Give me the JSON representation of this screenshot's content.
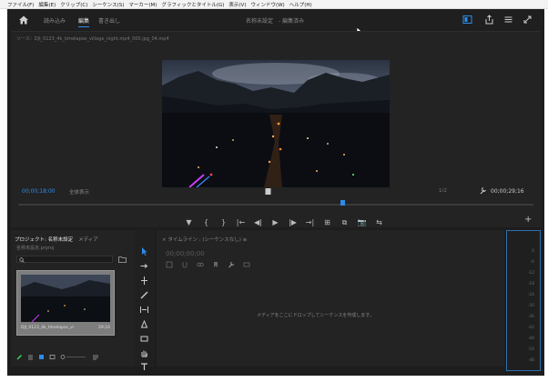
{
  "menu": [
    "ファイル(F)",
    "編集(E)",
    "クリップ(C)",
    "シーケンス(S)",
    "マーカー(M)",
    "グラフィックとタイトル(G)",
    "表示(V)",
    "ウィンドウ(W)",
    "ヘルプ(H)"
  ],
  "workspace": {
    "tabs": [
      "読み込み",
      "編集",
      "書き出し"
    ],
    "active_tab": "編集",
    "project_name": "名称未設定",
    "project_status": "- 編集済み"
  },
  "source_monitor": {
    "path": "ソース：DJI_0123_4k_timelapse_village_night.mp4_000.jpg_04.mp4",
    "timecode_current": "00;00;18;00",
    "fit_label": "全体表示",
    "quality_label": "1/2",
    "timecode_duration": "00;00;29;16"
  },
  "transport": [
    "▼",
    "{",
    "}",
    "|←",
    "◀|",
    "▶",
    "|▶",
    "→|",
    "⊞",
    "⧉",
    "⧉",
    "📷",
    "⇆"
  ],
  "project_panel": {
    "tab_active": "プロジェクト: 名称未設定",
    "tab_other": "メディア",
    "file_label": "名称未設定.prproj",
    "clip_name": "DJI_0123_4k_timelapse_vi",
    "clip_duration": "29;16"
  },
  "timeline": {
    "title": "× タイムライン : (シーケンスなし) ≡",
    "timecode": "00;00;00;00",
    "drop_hint": "メディアをここにドロップしてシーケンスを作成します。"
  },
  "meter_labels": [
    "0",
    "-6",
    "-12",
    "-18",
    "-24",
    "-30",
    "-36",
    "-42",
    "-48",
    "-54",
    "dB"
  ],
  "colors": {
    "accent": "#2d8ceb",
    "bg": "#1d1d1d",
    "panel": "#232323"
  }
}
